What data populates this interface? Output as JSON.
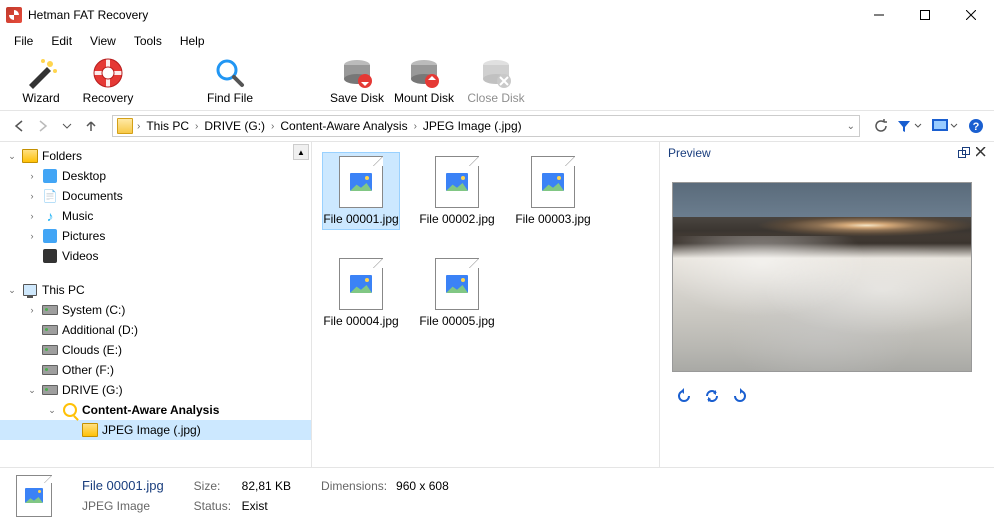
{
  "window": {
    "title": "Hetman FAT Recovery"
  },
  "menu": [
    "File",
    "Edit",
    "View",
    "Tools",
    "Help"
  ],
  "toolbar": [
    {
      "id": "wizard",
      "label": "Wizard"
    },
    {
      "id": "recovery",
      "label": "Recovery"
    },
    {
      "id": "findfile",
      "label": "Find File"
    },
    {
      "id": "savedisk",
      "label": "Save Disk"
    },
    {
      "id": "mountdisk",
      "label": "Mount Disk"
    },
    {
      "id": "closedisk",
      "label": "Close Disk",
      "disabled": true
    }
  ],
  "breadcrumb": [
    "This PC",
    "DRIVE (G:)",
    "Content-Aware Analysis",
    "JPEG Image (.jpg)"
  ],
  "tree": {
    "folders_root": "Folders",
    "folders": [
      "Desktop",
      "Documents",
      "Music",
      "Pictures",
      "Videos"
    ],
    "thispc_root": "This PC",
    "drives": [
      "System (C:)",
      "Additional (D:)",
      "Clouds (E:)",
      "Other (F:)",
      "DRIVE (G:)"
    ],
    "analysis": "Content-Aware Analysis",
    "subtype": "JPEG Image (.jpg)"
  },
  "files": [
    "File 00001.jpg",
    "File 00002.jpg",
    "File 00003.jpg",
    "File 00004.jpg",
    "File 00005.jpg"
  ],
  "preview": {
    "title": "Preview"
  },
  "status": {
    "filename": "File 00001.jpg",
    "filetype": "JPEG Image",
    "size_label": "Size:",
    "size_value": "82,81 KB",
    "status_label": "Status:",
    "status_value": "Exist",
    "dim_label": "Dimensions:",
    "dim_value": "960 x 608"
  }
}
